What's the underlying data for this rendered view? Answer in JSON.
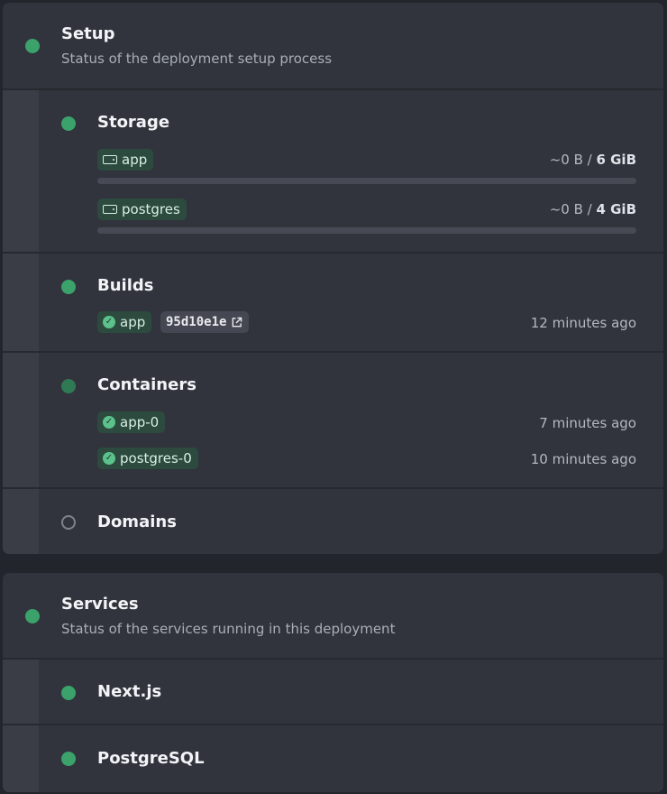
{
  "setup": {
    "title": "Setup",
    "subtitle": "Status of the deployment setup process",
    "storage": {
      "title": "Storage",
      "volumes": [
        {
          "name": "app",
          "used": "~0 B",
          "separator": " / ",
          "total": "6 GiB",
          "usage_fraction": 0
        },
        {
          "name": "postgres",
          "used": "~0 B",
          "separator": " / ",
          "total": "4 GiB",
          "usage_fraction": 0
        }
      ]
    },
    "builds": {
      "title": "Builds",
      "items": [
        {
          "name": "app",
          "commit": "95d10e1e",
          "time": "12 minutes ago"
        }
      ]
    },
    "containers": {
      "title": "Containers",
      "items": [
        {
          "name": "app-0",
          "time": "7 minutes ago"
        },
        {
          "name": "postgres-0",
          "time": "10 minutes ago"
        }
      ]
    },
    "domains": {
      "title": "Domains"
    }
  },
  "services": {
    "title": "Services",
    "subtitle": "Status of the services running in this deployment",
    "items": [
      {
        "name": "Next.js"
      },
      {
        "name": "PostgreSQL"
      }
    ]
  },
  "colors": {
    "status_green": "#3ba26b",
    "status_dark_green": "#2f7a55",
    "status_pending": "#7e838d",
    "chip_green_bg": "#2c4a3e"
  }
}
